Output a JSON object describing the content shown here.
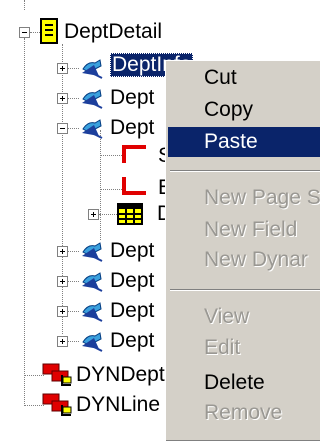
{
  "tree": {
    "root": {
      "label": "DeptDetail",
      "expander": "-"
    },
    "children": [
      {
        "label": "DeptInfo",
        "expander": "+",
        "icon": "scroll-icon",
        "selected": true
      },
      {
        "label": "Dept",
        "expander": "+",
        "icon": "scroll-icon"
      },
      {
        "label": "Dept",
        "expander": "-",
        "icon": "scroll-icon"
      },
      {
        "label": "Dept",
        "expander": "+",
        "icon": "scroll-icon"
      },
      {
        "label": "Dept",
        "expander": "+",
        "icon": "scroll-icon"
      },
      {
        "label": "Dept",
        "expander": "+",
        "icon": "scroll-icon"
      },
      {
        "label": "Dept",
        "expander": "+",
        "icon": "scroll-icon"
      }
    ],
    "grandchildren": [
      {
        "label": "S",
        "icon": "red-bracket-top-icon"
      },
      {
        "label": "E",
        "icon": "red-bracket-bottom-icon"
      },
      {
        "label": "D",
        "icon": "grid-table-icon",
        "expander": "+"
      }
    ],
    "dyn": [
      {
        "label": "DYNDept",
        "icon": "dyn-link-icon"
      },
      {
        "label": "DYNLine",
        "icon": "dyn-link-icon"
      }
    ]
  },
  "context_menu": {
    "items": [
      {
        "label": "Cut",
        "state": "enabled"
      },
      {
        "label": "Copy",
        "state": "enabled"
      },
      {
        "label": "Paste",
        "state": "highlighted"
      },
      {
        "label": "New Page S",
        "state": "disabled"
      },
      {
        "label": "New Field",
        "state": "disabled"
      },
      {
        "label": "New Dynar",
        "state": "disabled"
      },
      {
        "label": "View",
        "state": "disabled"
      },
      {
        "label": "Edit",
        "state": "disabled"
      },
      {
        "label": "Delete",
        "state": "enabled"
      },
      {
        "label": "Remove",
        "state": "disabled"
      }
    ]
  },
  "colors": {
    "selection": "#0a246a",
    "menu_bg": "#d4d0c8",
    "disabled_text": "#9a9893",
    "root_icon": "#ffff00",
    "bracket_red": "#e00000"
  }
}
